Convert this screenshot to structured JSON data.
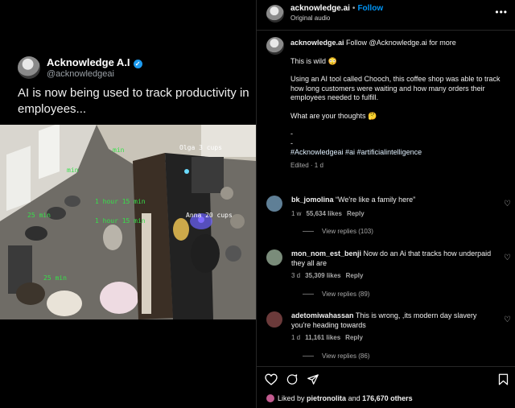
{
  "tweet": {
    "name": "Acknowledge A.I",
    "handle": "@acknowledgeai",
    "text": "AI is now being used to track productivity in employees..."
  },
  "camera_labels": [
    {
      "text": "Olga 3 cups",
      "color": "white"
    },
    {
      "text": "Anna 20 cups",
      "color": "white"
    },
    {
      "text": "1 hour 15 min",
      "color": "green"
    },
    {
      "text": "1 hour 15 min",
      "color": "green"
    },
    {
      "text": "25 min",
      "color": "green"
    },
    {
      "text": "25 min",
      "color": "green"
    },
    {
      "text": "min",
      "color": "green"
    },
    {
      "text": "min",
      "color": "green"
    }
  ],
  "header": {
    "username": "acknowledge.ai",
    "separator": "•",
    "follow_label": "Follow",
    "audio": "Original audio",
    "more": "•••"
  },
  "caption": {
    "username": "acknowledge.ai",
    "line1": "Follow @Acknowledge.ai for more",
    "p1": "This is wild 😳",
    "p2": "Using an AI tool called Chooch, this coffee shop was able to track how long customers were waiting and how many orders their employees needed to fulfill.",
    "p3": "What are your thoughts 🤔",
    "dash1": "-",
    "dash2": "-",
    "tags": "#Acknowledgeai #ai #artificialintelligence",
    "edited": "Edited · 1 d"
  },
  "comments": [
    {
      "user": "bk_jomolina",
      "text": "“We're like a family here”",
      "age": "1 w",
      "likes": "55,634 likes",
      "reply": "Reply",
      "views": "View replies (103)",
      "avatar_color": "#5f7f96"
    },
    {
      "user": "mon_nom_est_benji",
      "text": "Now do an Ai that tracks how underpaid they all are",
      "age": "3 d",
      "likes": "35,309 likes",
      "reply": "Reply",
      "views": "View replies (89)",
      "avatar_color": "#7a8c7a"
    },
    {
      "user": "adetomiwahassan",
      "text": "This is wrong, ,its modern day slavery you're heading towards",
      "age": "1 d",
      "likes": "11,161 likes",
      "reply": "Reply",
      "views": "View replies (86)",
      "avatar_color": "#6b3a3a"
    }
  ],
  "icons": {
    "heart": "heart-icon",
    "comment": "comment-icon",
    "share": "share-icon",
    "bookmark": "bookmark-icon",
    "more": "more-icon"
  },
  "likes_footer": {
    "prefix": "Liked by",
    "user": "pietronolita",
    "middle": "and",
    "count": "176,670 others"
  },
  "colors": {
    "follow_blue": "#0095f6",
    "background": "#000000",
    "detection_green": "#37e04a"
  }
}
